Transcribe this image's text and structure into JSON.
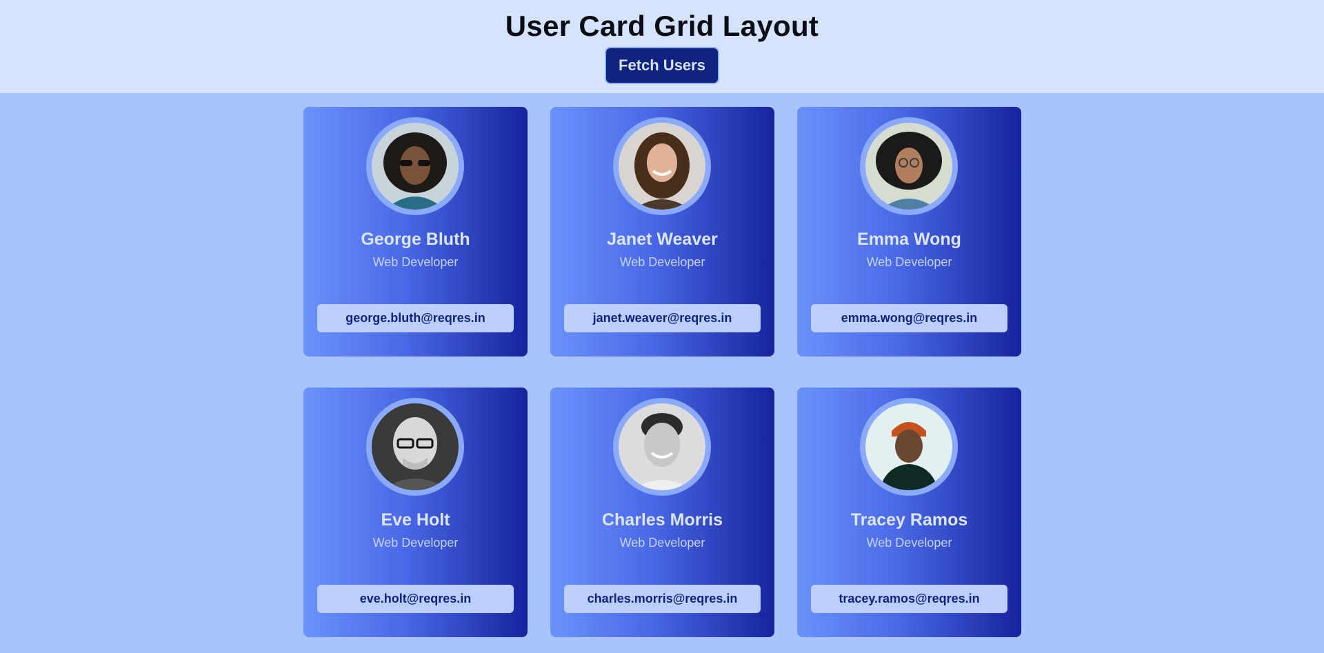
{
  "header": {
    "title": "User Card Grid Layout",
    "fetch_label": "Fetch Users"
  },
  "colors": {
    "header_bg": "#d6e3fe",
    "page_bg": "#a9c3fd",
    "button_bg": "#11237f",
    "card_gradient_start": "#6a92fb",
    "card_gradient_end": "#16239d",
    "email_bg": "#bccefc",
    "email_text": "#12237e"
  },
  "users": [
    {
      "name": "George Bluth",
      "role": "Web Developer",
      "email": "george.bluth@reqres.in",
      "avatar": "person-photo-icon"
    },
    {
      "name": "Janet Weaver",
      "role": "Web Developer",
      "email": "janet.weaver@reqres.in",
      "avatar": "person-photo-icon"
    },
    {
      "name": "Emma Wong",
      "role": "Web Developer",
      "email": "emma.wong@reqres.in",
      "avatar": "person-photo-icon"
    },
    {
      "name": "Eve Holt",
      "role": "Web Developer",
      "email": "eve.holt@reqres.in",
      "avatar": "person-photo-icon"
    },
    {
      "name": "Charles Morris",
      "role": "Web Developer",
      "email": "charles.morris@reqres.in",
      "avatar": "person-photo-icon"
    },
    {
      "name": "Tracey Ramos",
      "role": "Web Developer",
      "email": "tracey.ramos@reqres.in",
      "avatar": "person-photo-icon"
    }
  ]
}
